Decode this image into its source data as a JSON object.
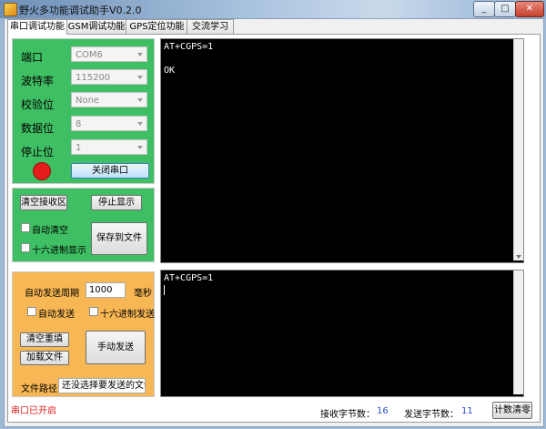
{
  "window": {
    "title": "野火多功能调试助手V0.2.0",
    "min": "_",
    "max": "□",
    "close": "✕"
  },
  "tabs": [
    "串口调试功能",
    "GSM调试功能",
    "GPS定位功能",
    "交流学习"
  ],
  "serial": {
    "port_label": "端口",
    "port_value": "COM6",
    "baud_label": "波特率",
    "baud_value": "115200",
    "parity_label": "校验位",
    "parity_value": "None",
    "databits_label": "数据位",
    "databits_value": "8",
    "stopbits_label": "停止位",
    "stopbits_value": "1",
    "close_port": "关闭串口"
  },
  "receive": {
    "clear": "清空接收区",
    "stop": "停止显示",
    "auto_clear": "自动清空",
    "hex_display": "十六进制显示",
    "save": "保存到文件",
    "line1": "AT+CGPS=1",
    "line2": "OK"
  },
  "send": {
    "period_label": "自动发送周期",
    "period_value": "1000",
    "period_unit": "毫秒",
    "auto_send": "自动发送",
    "hex_send": "十六进制发送",
    "clear_resend": "清空重填",
    "load_file": "加载文件",
    "manual_send": "手动发送",
    "file_path_label": "文件路径",
    "file_path_value": "还没选择要发送的文件",
    "text": "AT+CGPS=1"
  },
  "status": {
    "port_state": "串口已开启",
    "recv_label": "接收字节数：",
    "recv_count": "16",
    "send_label": "发送字节数：",
    "send_count": "11",
    "reset": "计数清零"
  },
  "colors": {
    "green_panel": "#3fbf63",
    "orange_panel": "#f7b754",
    "terminal": "#000000",
    "led": "#e41b1b"
  }
}
